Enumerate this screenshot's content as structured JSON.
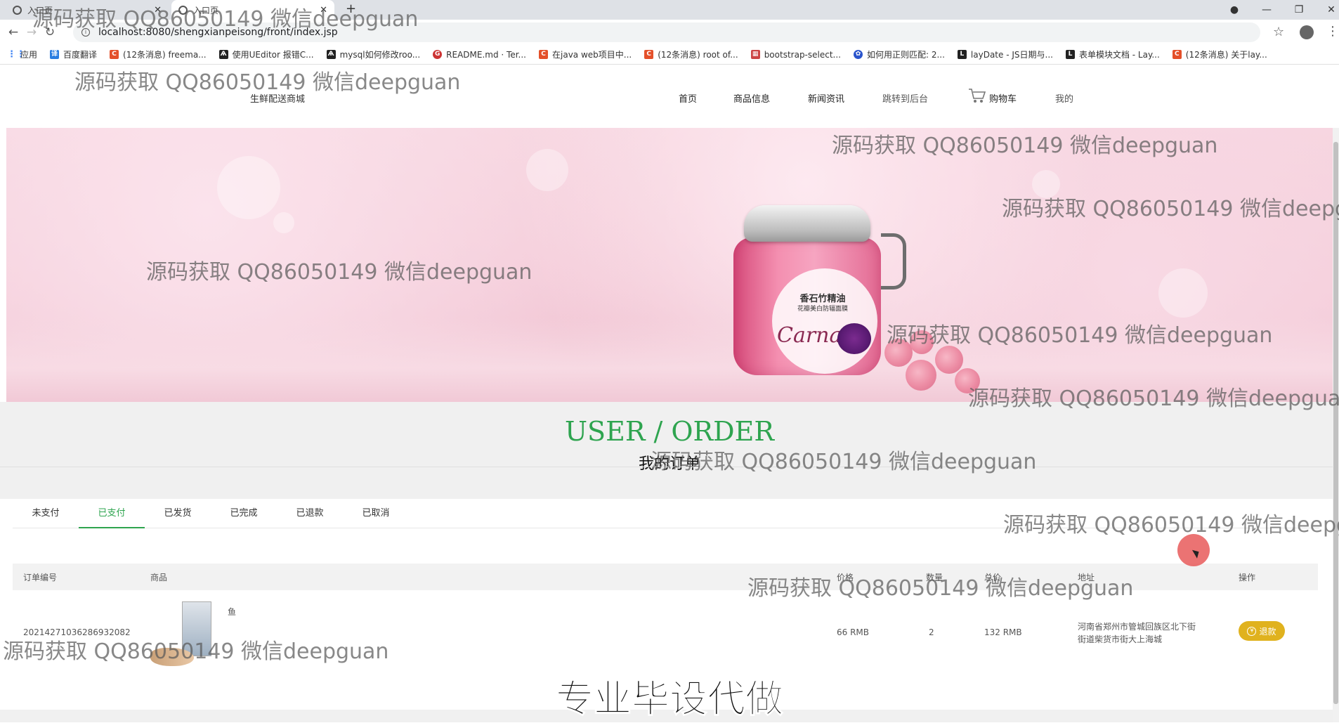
{
  "browser": {
    "tabs": [
      {
        "label": "入口页"
      },
      {
        "label": "入口页"
      }
    ],
    "url": "localhost:8080/shengxianpeisong/front/index.jsp",
    "bookmarks": [
      {
        "label": "应用",
        "icon": "apps-icon"
      },
      {
        "label": "百度翻译",
        "icon": "translate-icon"
      },
      {
        "label": "(12条消息) freema...",
        "icon": "csdn-icon"
      },
      {
        "label": "使用UEditor 报错C...",
        "icon": "bookmark-icon"
      },
      {
        "label": "mysql如何修改roo...",
        "icon": "bookmark-icon"
      },
      {
        "label": "README.md · Ter...",
        "icon": "gitee-icon"
      },
      {
        "label": "在java web项目中...",
        "icon": "csdn-icon"
      },
      {
        "label": "(12条消息) root of...",
        "icon": "csdn-icon"
      },
      {
        "label": "bootstrap-select...",
        "icon": "bookmark-icon"
      },
      {
        "label": "如何用正则匹配: 2...",
        "icon": "baidu-icon"
      },
      {
        "label": "layDate - JS日期与...",
        "icon": "layui-icon"
      },
      {
        "label": "表单模块文档 - Lay...",
        "icon": "layui-icon"
      },
      {
        "label": "(12条消息) 关于lay...",
        "icon": "csdn-icon"
      }
    ]
  },
  "site": {
    "brand": "生鲜配送商城",
    "nav": {
      "home": "首页",
      "goods": "商品信息",
      "news": "新闻资讯",
      "admin": "跳转到后台",
      "cart": "购物车",
      "mine": "我的"
    }
  },
  "banner": {
    "product_title": "香石竹精油",
    "product_subtitle": "花瓣美白防辐面膜",
    "product_script": "Carnatio"
  },
  "orders": {
    "title_en": "USER / ORDER",
    "title_cn": "我的订单",
    "tabs": [
      {
        "label": "未支付"
      },
      {
        "label": "已支付",
        "active": true
      },
      {
        "label": "已发货"
      },
      {
        "label": "已完成"
      },
      {
        "label": "已退款"
      },
      {
        "label": "已取消"
      }
    ],
    "columns": {
      "order_no": "订单编号",
      "product": "商品",
      "price": "价格",
      "quantity": "数量",
      "total": "总价",
      "address": "地址",
      "action": "操作"
    },
    "rows": [
      {
        "order_no": "20214271036286932082",
        "product_name": "鱼",
        "price": "66 RMB",
        "quantity": "2",
        "total": "132 RMB",
        "address_line1": "河南省郑州市管城回族区北下街",
        "address_line2": "街道柴货市街大上海城",
        "action": "退款"
      }
    ]
  },
  "overlays": {
    "watermark": "源码获取 QQ86050149 微信deepguan",
    "caption": "专业毕设代做"
  },
  "colors": {
    "accent_green": "#2ea44f",
    "refund_button": "#e0b21e"
  }
}
